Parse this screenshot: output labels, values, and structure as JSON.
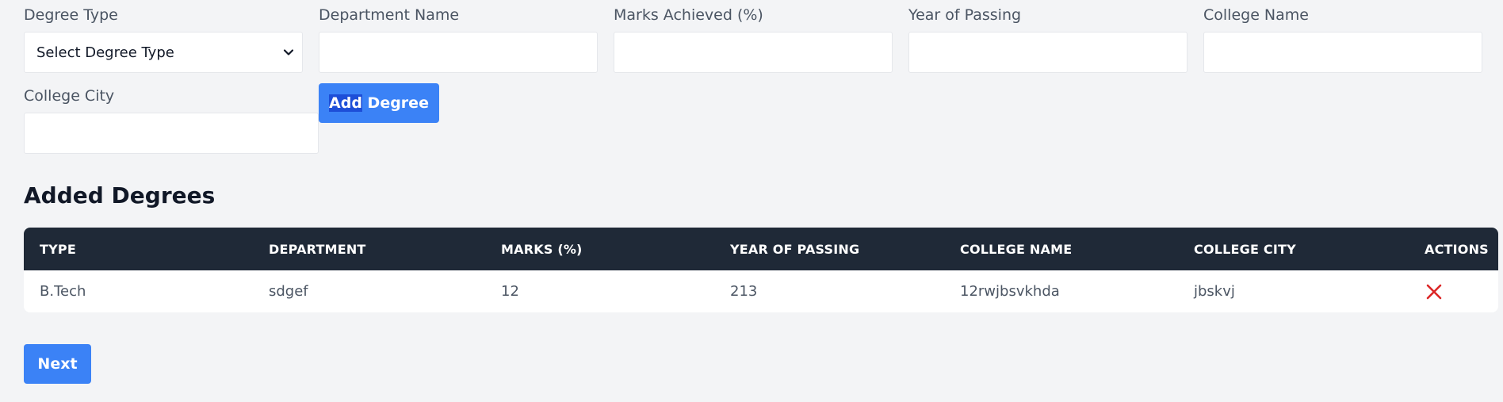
{
  "form": {
    "degree_type": {
      "label": "Degree Type",
      "selected": "Select Degree Type"
    },
    "department": {
      "label": "Department Name",
      "value": ""
    },
    "marks": {
      "label": "Marks Achieved (%)",
      "value": ""
    },
    "year": {
      "label": "Year of Passing",
      "value": ""
    },
    "college_name": {
      "label": "College Name",
      "value": ""
    },
    "college_city": {
      "label": "College City",
      "value": ""
    },
    "add_button": {
      "highlighted": "Add",
      "rest": " Degree"
    }
  },
  "section_title": "Added Degrees",
  "table": {
    "headers": [
      "TYPE",
      "DEPARTMENT",
      "MARKS (%)",
      "YEAR OF PASSING",
      "COLLEGE NAME",
      "COLLEGE CITY",
      "ACTIONS"
    ],
    "rows": [
      [
        "B.Tech",
        "sdgef",
        "12",
        "213",
        "12rwjbsvkhda",
        "jbskvj"
      ]
    ]
  },
  "next_button": "Next",
  "colors": {
    "primary": "#3b82f6",
    "header_bg": "#1f2937",
    "delete": "#dc2626"
  },
  "icons": {
    "select": "chevron-down-icon",
    "delete": "close-icon"
  }
}
